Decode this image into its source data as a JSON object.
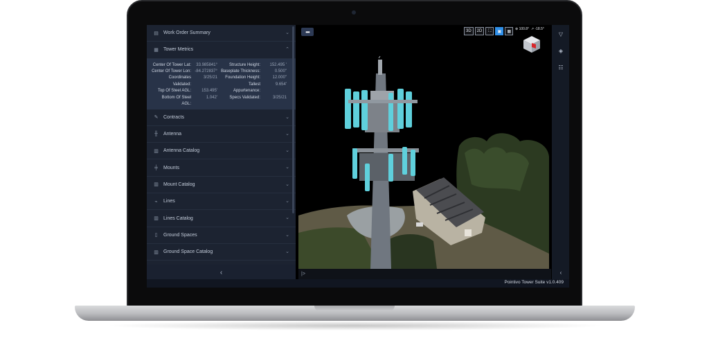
{
  "sidebar": {
    "sections": [
      {
        "label": "Work Order Summary",
        "icon": "document-icon"
      },
      {
        "label": "Tower Metrics",
        "icon": "table-icon",
        "expanded": true
      },
      {
        "label": "Contracts",
        "icon": "contract-icon"
      },
      {
        "label": "Antenna",
        "icon": "antenna-icon"
      },
      {
        "label": "Antenna Catalog",
        "icon": "catalog-icon"
      },
      {
        "label": "Mounts",
        "icon": "mount-icon"
      },
      {
        "label": "Mount Catalog",
        "icon": "catalog-icon"
      },
      {
        "label": "Lines",
        "icon": "lines-icon"
      },
      {
        "label": "Lines Catalog",
        "icon": "catalog-icon"
      },
      {
        "label": "Ground Spaces",
        "icon": "ground-icon"
      },
      {
        "label": "Ground Space Catalog",
        "icon": "catalog-icon"
      }
    ],
    "metrics_left": [
      {
        "key": "Center Of Tower Lat:",
        "value": "33.985841°"
      },
      {
        "key": "Center Of Tower Lon:",
        "value": "-84.272837°"
      },
      {
        "key": "Coordinates",
        "value": "3/25/21"
      },
      {
        "key": "Validated:",
        "value": ""
      },
      {
        "key": "Top Of Steel AGL:",
        "value": "153.495'"
      },
      {
        "key": "Bottom Of Steel",
        "value": "1.042'"
      },
      {
        "key": "AGL:",
        "value": ""
      }
    ],
    "metrics_right": [
      {
        "key": "Structure Height:",
        "value": "152.495 '"
      },
      {
        "key": "Baseplate Thickness:",
        "value": "0.500\""
      },
      {
        "key": "Foundation Height:",
        "value": "12.000\""
      },
      {
        "key": "Tallest",
        "value": "9.654'"
      },
      {
        "key": "Appurtenance:",
        "value": ""
      },
      {
        "key": "Specs Validated:",
        "value": "3/25/21"
      }
    ],
    "collapse_label": "‹"
  },
  "viewport": {
    "menu_label": "•••",
    "toggles": [
      "3D",
      "2D",
      "⛶",
      "▣",
      "▦"
    ],
    "active_toggle": 3,
    "orientation": [
      "⊕ 100.8°",
      "↗ -18.5°"
    ],
    "console_prompt": "|>"
  },
  "right_toolbar": {
    "icons": [
      "filter-icon",
      "layers-icon",
      "settings-sliders-icon"
    ],
    "collapse_label": "‹"
  },
  "app": {
    "version": "Pointivo Tower Suite v1.0.409"
  },
  "colors": {
    "panel": "#1c2331",
    "metrics_bg": "#283348",
    "accent": "#2f8fe8",
    "antenna": "#5fd0dc"
  }
}
